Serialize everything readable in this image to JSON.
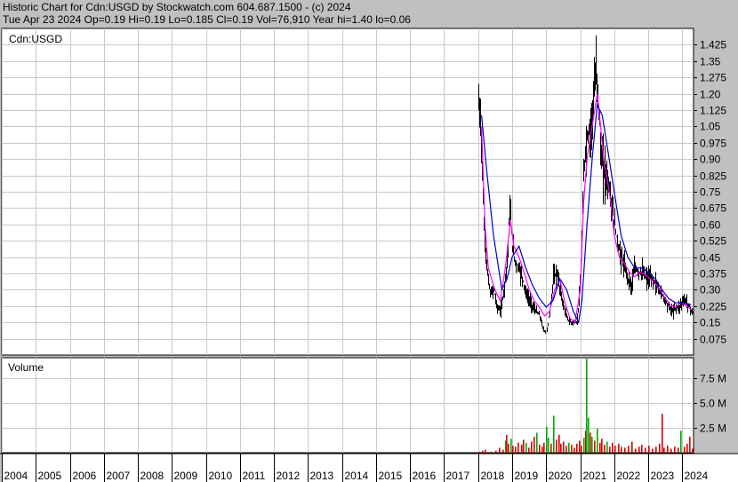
{
  "header": {
    "line1": "Historic Chart for Cdn:USGD by Stockwatch.com 604.687.1500 - (c) 2024",
    "line2": "Tue Apr 23 2024   Op=0.19   Hi=0.19   Lo=0.185   Cl=0.19   Vol=76,910   Year hi=1.40   lo=0.06"
  },
  "colors": {
    "price_bar": "#000000",
    "ma_fast": "#ff00ff",
    "ma_slow": "#0000cc",
    "vol_up": "#00aa00",
    "vol_down": "#dd0000",
    "grid": "#c8c8c8",
    "background": "#ffffff",
    "frame": "#c0c0c0"
  },
  "chart_data": [
    {
      "type": "line",
      "title": "Cdn:USGD",
      "ylim": [
        0,
        1.5
      ],
      "yticks": [
        "0.075",
        "0.15",
        "0.225",
        "0.30",
        "0.375",
        "0.45",
        "0.525",
        "0.60",
        "0.675",
        "0.75",
        "0.825",
        "0.90",
        "0.975",
        "1.05",
        "1.125",
        "1.20",
        "1.275",
        "1.35",
        "1.425"
      ],
      "xticks": [
        "2004",
        "2005",
        "2006",
        "2007",
        "2008",
        "2009",
        "2010",
        "2011",
        "2012",
        "2013",
        "2014",
        "2015",
        "2016",
        "2017",
        "2018",
        "2019",
        "2020",
        "2021",
        "2022",
        "2023",
        "2024"
      ],
      "grid": true,
      "series": [
        {
          "kind": "close",
          "x": [
            2018.0,
            2018.05,
            2018.1,
            2018.15,
            2018.2,
            2018.25,
            2018.3,
            2018.35,
            2018.45,
            2018.55,
            2018.65,
            2018.75,
            2018.85,
            2018.92,
            2019.0,
            2019.05,
            2019.1,
            2019.2,
            2019.3,
            2019.4,
            2019.5,
            2019.6,
            2019.7,
            2019.8,
            2019.9,
            2020.0,
            2020.1,
            2020.2,
            2020.3,
            2020.4,
            2020.5,
            2020.55,
            2020.6,
            2020.7,
            2020.8,
            2020.9,
            2021.0,
            2021.05,
            2021.1,
            2021.15,
            2021.2,
            2021.3,
            2021.4,
            2021.45,
            2021.5,
            2021.55,
            2021.6,
            2021.7,
            2021.8,
            2021.9,
            2022.0,
            2022.1,
            2022.2,
            2022.3,
            2022.4,
            2022.5,
            2022.6,
            2022.7,
            2022.8,
            2022.9,
            2023.0,
            2023.1,
            2023.2,
            2023.3,
            2023.4,
            2023.5,
            2023.6,
            2023.7,
            2023.8,
            2023.9,
            2024.0,
            2024.1,
            2024.2,
            2024.31
          ],
          "values": [
            1.15,
            1.1,
            0.95,
            0.62,
            0.5,
            0.4,
            0.33,
            0.28,
            0.3,
            0.22,
            0.2,
            0.3,
            0.45,
            0.68,
            0.5,
            0.45,
            0.42,
            0.4,
            0.35,
            0.28,
            0.25,
            0.22,
            0.2,
            0.18,
            0.12,
            0.1,
            0.2,
            0.35,
            0.38,
            0.3,
            0.22,
            0.2,
            0.17,
            0.15,
            0.15,
            0.15,
            0.35,
            0.6,
            0.85,
            0.95,
            1.0,
            1.05,
            1.2,
            1.3,
            1.25,
            1.1,
            0.9,
            0.85,
            0.8,
            0.7,
            0.6,
            0.5,
            0.45,
            0.4,
            0.35,
            0.32,
            0.4,
            0.38,
            0.38,
            0.36,
            0.35,
            0.35,
            0.33,
            0.3,
            0.28,
            0.25,
            0.22,
            0.2,
            0.22,
            0.22,
            0.25,
            0.25,
            0.22,
            0.19
          ]
        },
        {
          "kind": "ma_fast",
          "x": [
            2018.1,
            2018.2,
            2018.3,
            2018.45,
            2018.55,
            2018.65,
            2018.8,
            2018.95,
            2019.05,
            2019.2,
            2019.35,
            2019.5,
            2019.65,
            2019.8,
            2019.95,
            2020.1,
            2020.25,
            2020.4,
            2020.55,
            2020.7,
            2020.85,
            2021.0,
            2021.1,
            2021.2,
            2021.3,
            2021.4,
            2021.5,
            2021.6,
            2021.7,
            2021.8,
            2021.9,
            2022.0,
            2022.15,
            2022.3,
            2022.45,
            2022.6,
            2022.75,
            2022.9,
            2023.05,
            2023.2,
            2023.35,
            2023.5,
            2023.65,
            2023.8,
            2023.95,
            2024.1,
            2024.25
          ],
          "values": [
            1.05,
            0.6,
            0.4,
            0.32,
            0.28,
            0.25,
            0.4,
            0.62,
            0.5,
            0.45,
            0.38,
            0.3,
            0.25,
            0.22,
            0.18,
            0.2,
            0.3,
            0.35,
            0.24,
            0.17,
            0.15,
            0.3,
            0.7,
            0.9,
            1.0,
            1.1,
            1.2,
            1.05,
            0.88,
            0.8,
            0.7,
            0.55,
            0.45,
            0.42,
            0.38,
            0.36,
            0.38,
            0.37,
            0.35,
            0.33,
            0.3,
            0.26,
            0.23,
            0.22,
            0.24,
            0.23,
            0.21
          ]
        },
        {
          "kind": "ma_slow",
          "x": [
            2018.1,
            2018.25,
            2018.45,
            2018.7,
            2018.85,
            2019.0,
            2019.2,
            2019.4,
            2019.6,
            2019.8,
            2020.0,
            2020.2,
            2020.4,
            2020.6,
            2020.8,
            2020.95,
            2021.05,
            2021.2,
            2021.35,
            2021.5,
            2021.65,
            2021.8,
            2022.0,
            2022.2,
            2022.4,
            2022.6,
            2022.8,
            2023.0,
            2023.2,
            2023.4,
            2023.6,
            2023.8,
            2024.0,
            2024.25
          ],
          "values": [
            1.1,
            0.85,
            0.55,
            0.3,
            0.35,
            0.45,
            0.5,
            0.4,
            0.32,
            0.26,
            0.22,
            0.25,
            0.35,
            0.3,
            0.2,
            0.15,
            0.25,
            0.6,
            0.9,
            1.15,
            1.1,
            0.95,
            0.75,
            0.55,
            0.45,
            0.4,
            0.4,
            0.38,
            0.35,
            0.3,
            0.26,
            0.24,
            0.24,
            0.23
          ]
        }
      ]
    },
    {
      "type": "bar",
      "title": "Volume",
      "ylim": [
        0,
        9.5
      ],
      "yticks": [
        "2.5 M",
        "5.0 M",
        "7.5 M"
      ],
      "unit": "M",
      "values": [
        [
          2018.0,
          0.1,
          "down"
        ],
        [
          2018.1,
          0.2,
          "down"
        ],
        [
          2018.2,
          0.3,
          "down"
        ],
        [
          2018.35,
          0.1,
          "down"
        ],
        [
          2018.5,
          0.2,
          "down"
        ],
        [
          2018.6,
          0.5,
          "down"
        ],
        [
          2018.7,
          0.3,
          "down"
        ],
        [
          2018.78,
          1.2,
          "up"
        ],
        [
          2018.82,
          1.8,
          "down"
        ],
        [
          2018.88,
          0.9,
          "down"
        ],
        [
          2018.95,
          1.4,
          "up"
        ],
        [
          2019.0,
          0.7,
          "down"
        ],
        [
          2019.08,
          0.6,
          "down"
        ],
        [
          2019.15,
          1.0,
          "down"
        ],
        [
          2019.25,
          0.8,
          "down"
        ],
        [
          2019.32,
          1.3,
          "down"
        ],
        [
          2019.4,
          1.0,
          "up"
        ],
        [
          2019.48,
          0.5,
          "down"
        ],
        [
          2019.55,
          1.1,
          "down"
        ],
        [
          2019.62,
          1.6,
          "down"
        ],
        [
          2019.7,
          2.0,
          "up"
        ],
        [
          2019.78,
          0.8,
          "down"
        ],
        [
          2019.85,
          0.6,
          "down"
        ],
        [
          2019.92,
          1.0,
          "down"
        ],
        [
          2020.0,
          2.6,
          "up"
        ],
        [
          2020.05,
          1.5,
          "up"
        ],
        [
          2020.12,
          0.9,
          "down"
        ],
        [
          2020.2,
          3.7,
          "up"
        ],
        [
          2020.28,
          1.3,
          "down"
        ],
        [
          2020.35,
          1.8,
          "down"
        ],
        [
          2020.42,
          0.9,
          "down"
        ],
        [
          2020.5,
          1.1,
          "down"
        ],
        [
          2020.58,
          0.7,
          "down"
        ],
        [
          2020.65,
          1.0,
          "up"
        ],
        [
          2020.72,
          0.8,
          "down"
        ],
        [
          2020.8,
          0.5,
          "down"
        ],
        [
          2020.88,
          0.9,
          "down"
        ],
        [
          2020.95,
          1.2,
          "down"
        ],
        [
          2021.02,
          0.7,
          "down"
        ],
        [
          2021.08,
          1.5,
          "up"
        ],
        [
          2021.13,
          2.2,
          "down"
        ],
        [
          2021.18,
          9.4,
          "up"
        ],
        [
          2021.22,
          3.5,
          "up"
        ],
        [
          2021.26,
          2.0,
          "down"
        ],
        [
          2021.32,
          1.6,
          "up"
        ],
        [
          2021.4,
          1.2,
          "down"
        ],
        [
          2021.48,
          2.4,
          "up"
        ],
        [
          2021.55,
          1.0,
          "down"
        ],
        [
          2021.62,
          1.4,
          "down"
        ],
        [
          2021.7,
          0.8,
          "down"
        ],
        [
          2021.78,
          1.1,
          "up"
        ],
        [
          2021.85,
          0.6,
          "down"
        ],
        [
          2021.92,
          1.0,
          "down"
        ],
        [
          2022.0,
          0.7,
          "down"
        ],
        [
          2022.1,
          0.9,
          "down"
        ],
        [
          2022.2,
          0.6,
          "down"
        ],
        [
          2022.3,
          0.5,
          "down"
        ],
        [
          2022.4,
          0.7,
          "down"
        ],
        [
          2022.5,
          1.1,
          "down"
        ],
        [
          2022.6,
          0.4,
          "down"
        ],
        [
          2022.7,
          0.6,
          "down"
        ],
        [
          2022.8,
          0.8,
          "down"
        ],
        [
          2022.9,
          0.5,
          "down"
        ],
        [
          2023.0,
          0.7,
          "down"
        ],
        [
          2023.1,
          0.4,
          "down"
        ],
        [
          2023.2,
          0.6,
          "down"
        ],
        [
          2023.3,
          0.9,
          "down"
        ],
        [
          2023.38,
          3.9,
          "down"
        ],
        [
          2023.45,
          0.5,
          "down"
        ],
        [
          2023.55,
          0.7,
          "down"
        ],
        [
          2023.65,
          0.4,
          "down"
        ],
        [
          2023.75,
          0.6,
          "down"
        ],
        [
          2023.85,
          0.5,
          "down"
        ],
        [
          2023.95,
          2.2,
          "up"
        ],
        [
          2024.05,
          0.6,
          "down"
        ],
        [
          2024.12,
          0.9,
          "down"
        ],
        [
          2024.2,
          1.6,
          "down"
        ],
        [
          2024.28,
          0.4,
          "down"
        ]
      ]
    }
  ]
}
